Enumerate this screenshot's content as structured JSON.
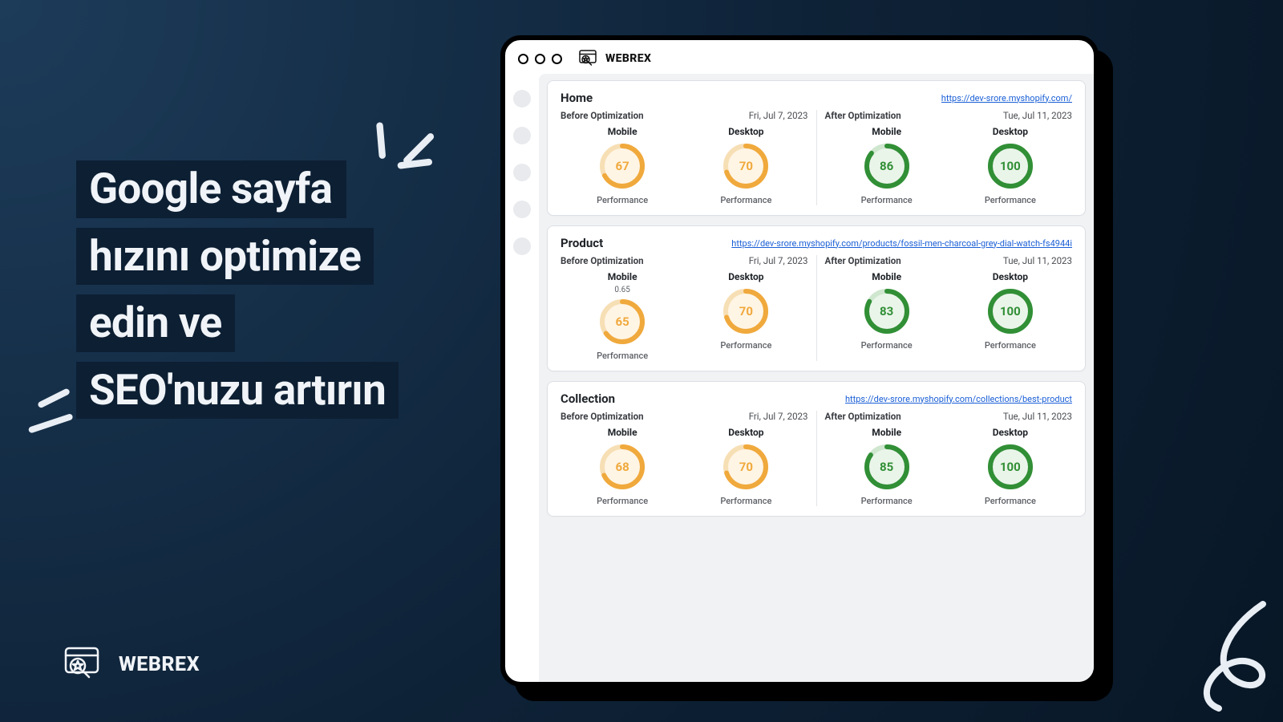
{
  "brand": "WEBREX",
  "headline": {
    "line1": "Google sayfa",
    "line2": "hızını optimize",
    "line3": "edin ve",
    "line4": "SEO'nuzu artırın"
  },
  "labels": {
    "before": "Before Optimization",
    "after": "After Optimization",
    "mobile": "Mobile",
    "desktop": "Desktop",
    "performance": "Performance"
  },
  "colors": {
    "orange": "#f0a93c",
    "green": "#318f36"
  },
  "panels": [
    {
      "title": "Home",
      "url": "https://dev-srore.myshopify.com/",
      "before": {
        "date": "Fri, Jul 7, 2023",
        "mobile": {
          "score": 67
        },
        "desktop": {
          "score": 70
        }
      },
      "after": {
        "date": "Tue, Jul 11, 2023",
        "mobile": {
          "score": 86
        },
        "desktop": {
          "score": 100
        }
      }
    },
    {
      "title": "Product",
      "url": "https://dev-srore.myshopify.com/products/fossil-men-charcoal-grey-dial-watch-fs4944i",
      "before": {
        "date": "Fri, Jul 7, 2023",
        "mobile": {
          "aux": "0.65",
          "score": 65
        },
        "desktop": {
          "score": 70
        }
      },
      "after": {
        "date": "Tue, Jul 11, 2023",
        "mobile": {
          "score": 83
        },
        "desktop": {
          "score": 100
        }
      }
    },
    {
      "title": "Collection",
      "url": "https://dev-srore.myshopify.com/collections/best-product",
      "before": {
        "date": "Fri, Jul 7, 2023",
        "mobile": {
          "score": 68
        },
        "desktop": {
          "score": 70
        }
      },
      "after": {
        "date": "Tue, Jul 11, 2023",
        "mobile": {
          "score": 85
        },
        "desktop": {
          "score": 100
        }
      }
    }
  ]
}
